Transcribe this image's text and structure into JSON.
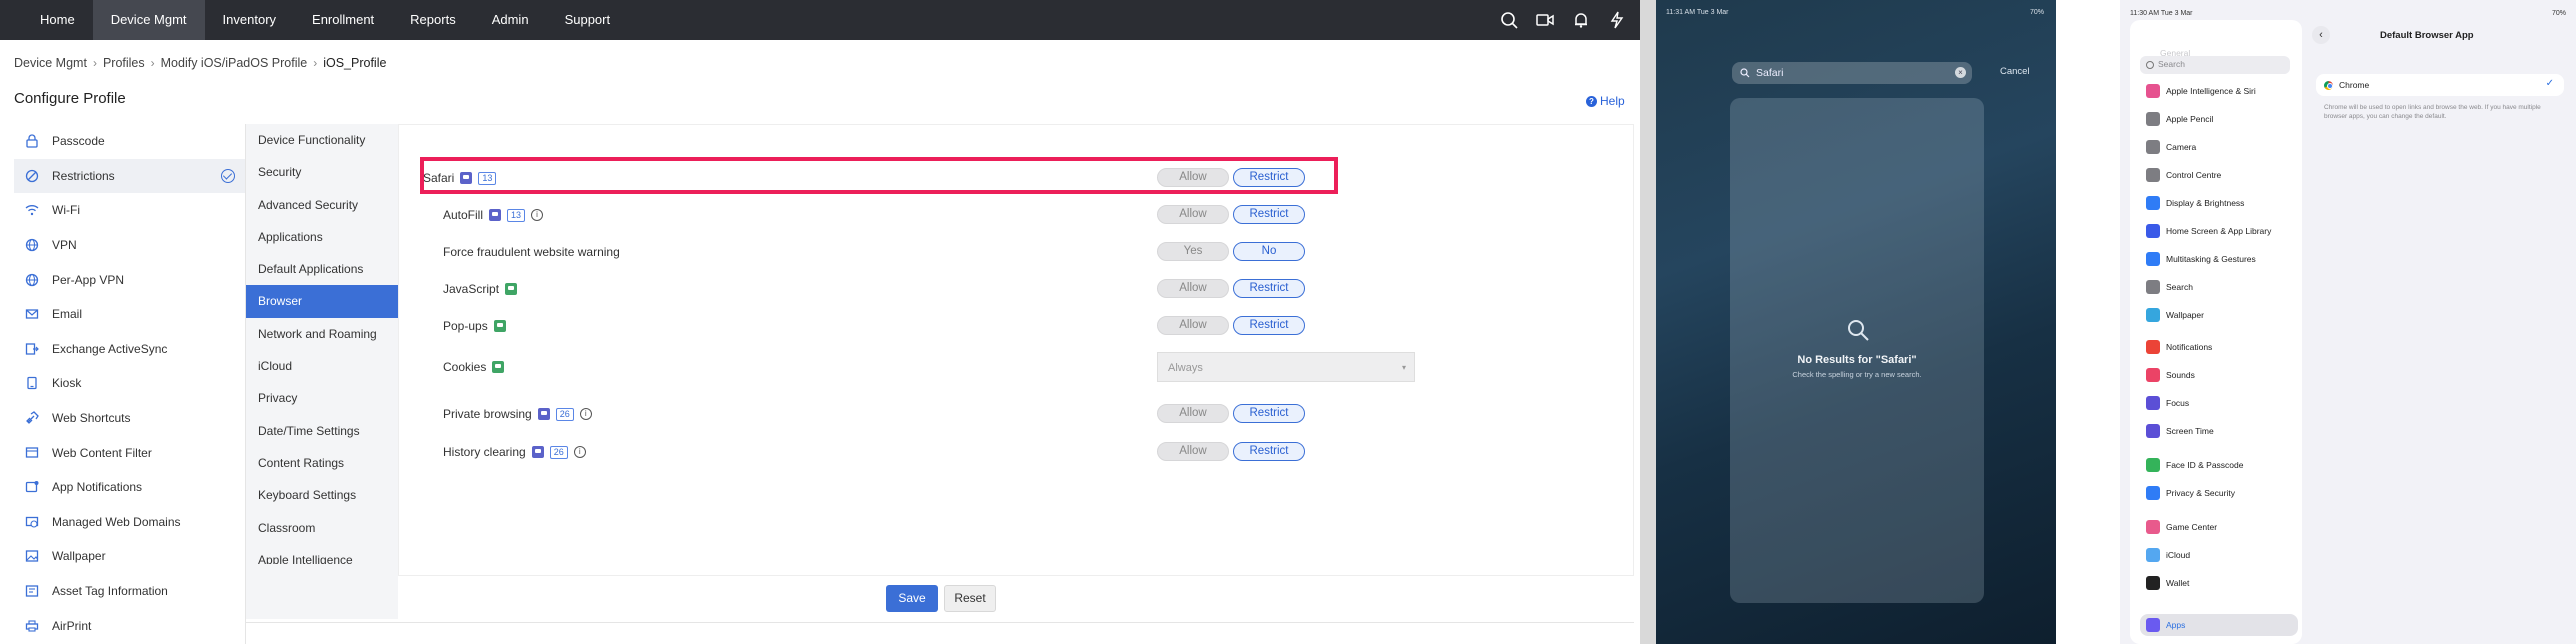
{
  "nav": {
    "items": [
      "Home",
      "Device Mgmt",
      "Inventory",
      "Enrollment",
      "Reports",
      "Admin",
      "Support"
    ],
    "active": "Device Mgmt",
    "icons": [
      "search-icon",
      "video-icon",
      "bell-icon",
      "rocket-icon",
      "lightning-icon"
    ]
  },
  "breadcrumb": [
    "Device Mgmt",
    "Profiles",
    "Modify iOS/iPadOS Profile",
    "iOS_Profile"
  ],
  "page_title": "Configure Profile",
  "help_label": "Help",
  "sidebar": {
    "items": [
      {
        "label": "Passcode",
        "icon": "lock-icon"
      },
      {
        "label": "Restrictions",
        "icon": "restrict-icon",
        "active": true
      },
      {
        "label": "Wi-Fi",
        "icon": "wifi-icon"
      },
      {
        "label": "VPN",
        "icon": "globe-icon"
      },
      {
        "label": "Per-App VPN",
        "icon": "globe-icon"
      },
      {
        "label": "Email",
        "icon": "mail-icon"
      },
      {
        "label": "Exchange ActiveSync",
        "icon": "sync-icon"
      },
      {
        "label": "Kiosk",
        "icon": "kiosk-icon"
      },
      {
        "label": "Web Shortcuts",
        "icon": "link-icon"
      },
      {
        "label": "Web Content Filter",
        "icon": "filter-icon"
      },
      {
        "label": "App Notifications",
        "icon": "notification-icon"
      },
      {
        "label": "Managed Web Domains",
        "icon": "domain-icon"
      },
      {
        "label": "Wallpaper",
        "icon": "image-icon"
      },
      {
        "label": "Asset Tag Information",
        "icon": "tag-icon"
      },
      {
        "label": "AirPrint",
        "icon": "printer-icon"
      }
    ]
  },
  "subnav": {
    "items": [
      "Device Functionality",
      "Security",
      "Advanced Security",
      "Applications",
      "Default Applications",
      "Browser",
      "Network and Roaming",
      "iCloud",
      "Privacy",
      "Date/Time Settings",
      "Content Ratings",
      "Keyboard Settings",
      "Classroom",
      "Apple Intelligence"
    ],
    "active": "Browser"
  },
  "browser_settings": [
    {
      "label": "Safari",
      "badge": "purple",
      "version": "13",
      "off": "Allow",
      "on": "Restrict"
    },
    {
      "label": "AutoFill",
      "badge": "purple",
      "version": "13",
      "info": true,
      "off": "Allow",
      "on": "Restrict"
    },
    {
      "label": "Force fraudulent website warning",
      "off": "Yes",
      "on": "No"
    },
    {
      "label": "JavaScript",
      "badge": "green",
      "off": "Allow",
      "on": "Restrict"
    },
    {
      "label": "Pop-ups",
      "badge": "green",
      "off": "Allow",
      "on": "Restrict"
    },
    {
      "label": "Cookies",
      "badge": "green",
      "select": "Always"
    },
    {
      "label": "Private browsing",
      "badge": "purple",
      "version": "26",
      "info": true,
      "off": "Allow",
      "on": "Restrict"
    },
    {
      "label": "History clearing",
      "badge": "purple",
      "version": "26",
      "info": true,
      "off": "Allow",
      "on": "Restrict"
    }
  ],
  "buttons": {
    "save": "Save",
    "reset": "Reset"
  },
  "colors": {
    "highlight": "#ec1f59",
    "accent": "#3b6fd6",
    "nav_bg": "#2b2d33"
  },
  "ipad_search": {
    "time": "11:31 AM  Tue 3 Mar",
    "battery": "70%",
    "query": "Safari",
    "cancel": "Cancel",
    "no_results": "No Results for \"Safari\"",
    "hint": "Check the spelling or try a new search."
  },
  "ipad_settings": {
    "time": "11:30 AM  Tue 3 Mar",
    "battery": "70%",
    "dim_label": "General",
    "search_placeholder": "Search",
    "items": [
      {
        "label": "Apple Intelligence & Siri",
        "color": "#e6528f"
      },
      {
        "label": "Apple Pencil",
        "color": "#7d7d82"
      },
      {
        "label": "Camera",
        "color": "#7d7d82"
      },
      {
        "label": "Control Centre",
        "color": "#7d7d82"
      },
      {
        "label": "Display & Brightness",
        "color": "#2f7cf6"
      },
      {
        "label": "Home Screen & App Library",
        "color": "#3a5ae8"
      },
      {
        "label": "Multitasking & Gestures",
        "color": "#2f7cf6"
      },
      {
        "label": "Search",
        "color": "#7d7d82"
      },
      {
        "label": "Wallpaper",
        "color": "#35a6de"
      },
      {
        "label": "Notifications",
        "color": "#eb4337"
      },
      {
        "label": "Sounds",
        "color": "#eb4366"
      },
      {
        "label": "Focus",
        "color": "#5b4fd6"
      },
      {
        "label": "Screen Time",
        "color": "#5b4fd6"
      },
      {
        "label": "Face ID & Passcode",
        "color": "#34b35a"
      },
      {
        "label": "Privacy & Security",
        "color": "#2f7cf6"
      },
      {
        "label": "Game Center",
        "color": "#e85a8c"
      },
      {
        "label": "iCloud",
        "color": "#54a7f0"
      },
      {
        "label": "Wallet",
        "color": "#222222"
      },
      {
        "label": "Apps",
        "color": "#6a5af0",
        "active": true
      }
    ],
    "detail_title": "Default Browser App",
    "selected_browser": "Chrome",
    "footnote": "Chrome will be used to open links and browse the web. If you have multiple browser apps, you can change the default."
  }
}
